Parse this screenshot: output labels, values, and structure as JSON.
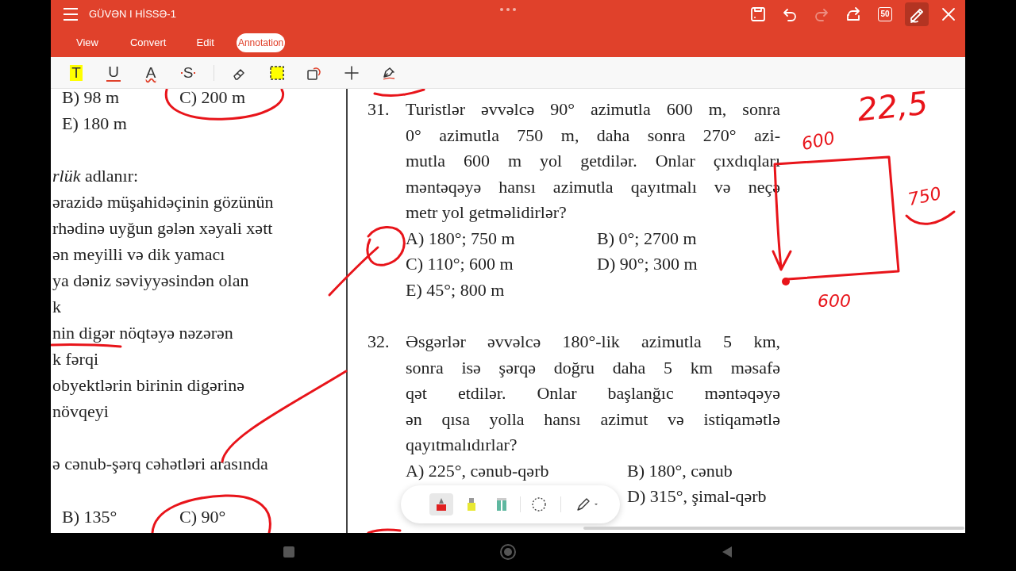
{
  "app_bar": {
    "title": "GÜVƏN I HİSSƏ-1",
    "actions": [
      {
        "kind": "save",
        "disabled": false
      },
      {
        "kind": "undo",
        "disabled": false
      },
      {
        "kind": "redo",
        "disabled": true
      },
      {
        "kind": "share",
        "disabled": false
      },
      {
        "kind": "pages",
        "label": "50",
        "disabled": false
      },
      {
        "kind": "annotate",
        "disabled": false,
        "on": true
      },
      {
        "kind": "close",
        "disabled": false
      }
    ]
  },
  "tabs": [
    {
      "label": "View",
      "selected": false
    },
    {
      "label": "Convert",
      "selected": false
    },
    {
      "label": "Edit",
      "selected": false
    },
    {
      "label": "Annotation",
      "selected": true
    }
  ],
  "annotation_tools": [
    {
      "kind": "highlight",
      "glyph": "T"
    },
    {
      "kind": "underline",
      "glyph": "U"
    },
    {
      "kind": "squiggly",
      "glyph": "A"
    },
    {
      "kind": "strikeout",
      "glyph": "S"
    },
    {
      "kind": "eraser"
    },
    {
      "kind": "area"
    },
    {
      "kind": "shape"
    },
    {
      "kind": "add"
    },
    {
      "kind": "sign"
    }
  ],
  "document": {
    "left_column": [
      {
        "kind": "options",
        "left": "B) 98 m",
        "right": "C) 200 m"
      },
      {
        "kind": "options",
        "left": "E) 180 m"
      },
      {
        "kind": "line",
        "text": "*rlük* adlanır:"
      },
      {
        "kind": "line",
        "text": "ərazidə müşahidəçinin gözünün"
      },
      {
        "kind": "line",
        "text": "rhədinə uyğun gələn xəyali xətt"
      },
      {
        "kind": "line",
        "text": "ən meyilli və dik yamacı"
      },
      {
        "kind": "line",
        "text": "ya dəniz səviyyəsindən olan"
      },
      {
        "kind": "line",
        "text": "k"
      },
      {
        "kind": "line",
        "text": "nin digər nöqtəyə nəzərən"
      },
      {
        "kind": "line",
        "text": "k fərqi"
      },
      {
        "kind": "line",
        "text": "obyektlərin birinin digərinə"
      },
      {
        "kind": "line",
        "text": "növqeyi"
      },
      {
        "kind": "line",
        "text": "ə cənub-şərq cəhətləri arasında"
      },
      {
        "kind": "options",
        "left": "B) 135°",
        "right": "C) 90°"
      }
    ],
    "questions": [
      {
        "number": "31.",
        "lines": [
          "Turistlər əvvəlcə 90° azimutla 600 m, sonra",
          "0° azimutla 750 m, daha sonra 270° azi-",
          "mutla 600 m yol getdilər. Onlar çıxdıqları",
          "məntəqəyə hansı azimutla qayıtmalı və neçə",
          "metr yol getməlidirlər?"
        ],
        "options": [
          {
            "left": "A) 180°; 750 m",
            "right": "B) 0°; 2700 m"
          },
          {
            "left": "C) 110°; 600 m",
            "right": "D) 90°; 300 m"
          },
          {
            "left": "E) 45°; 800 m"
          }
        ]
      },
      {
        "number": "32.",
        "lines": [
          "Əsgərlər əvvəlcə 180°-lik azimutla 5 km,",
          "sonra isə şərqə doğru daha 5 km məsafə",
          "qət etdilər. Onlar başlanğıc məntəqəyə",
          "ən qısa yolla hansı azimut və istiqamətlə",
          "qayıtmalıdırlar?"
        ],
        "options": [
          {
            "left": "A) 225°, cənub-qərb",
            "right": "B) 180°, cənub"
          },
          {
            "right": "D) 315°, şimal-qərb"
          }
        ]
      }
    ],
    "notes": [
      "22,5",
      "600",
      "750",
      "600"
    ]
  },
  "pen_toolbar": [
    {
      "kind": "marker",
      "color": "#e02020",
      "selected": true
    },
    {
      "kind": "highlighter",
      "color": "#e8e832",
      "selected": false
    },
    {
      "kind": "tape",
      "color": "#5fb8a0",
      "selected": false
    },
    {
      "kind": "lasso",
      "selected": false
    },
    {
      "kind": "pencil",
      "selected": false
    }
  ]
}
